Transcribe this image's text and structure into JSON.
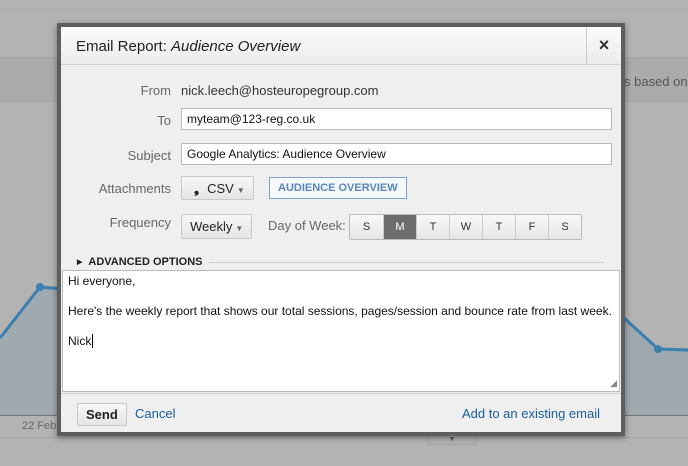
{
  "background": {
    "note": "s based on",
    "date_label": "22 Feb",
    "collapse_icon": "▼"
  },
  "dialog": {
    "title_prefix": "Email Report: ",
    "title_report": "Audience Overview",
    "close": "×",
    "from_label": "From",
    "from_value": "nick.leech@hosteuropegroup.com",
    "to_label": "To",
    "to_value": "myteam@123-reg.co.uk",
    "subject_label": "Subject",
    "subject_value": "Google Analytics: Audience Overview",
    "attachments_label": "Attachments",
    "format_icon": "❟",
    "format": "CSV",
    "attachment_tag": "AUDIENCE OVERVIEW",
    "frequency_label": "Frequency",
    "frequency": "Weekly",
    "dow_label": "Day of Week:",
    "days": [
      "S",
      "M",
      "T",
      "W",
      "T",
      "F",
      "S"
    ],
    "selected_day": "M",
    "advanced": "ADVANCED OPTIONS",
    "message": {
      "line1": "Hi everyone,",
      "line2": "Here's the weekly report that shows our total sessions, pages/session and bounce rate from last week.",
      "line3": "Nick"
    },
    "send": "Send",
    "cancel": "Cancel",
    "add_existing": "Add to an existing email"
  },
  "colors": {
    "accent": "#1a5f9c",
    "chart_line": "#3b7fb0",
    "selected_day": "#6d6d6d"
  }
}
